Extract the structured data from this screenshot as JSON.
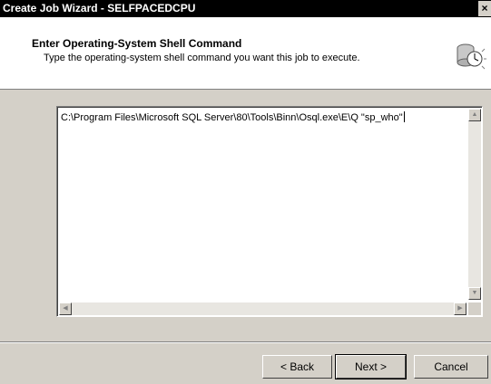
{
  "window": {
    "title": "Create Job Wizard - SELFPACEDCPU",
    "close_glyph": "×"
  },
  "header": {
    "title": "Enter Operating-System Shell Command",
    "subtitle": "Type the operating-system shell command you want this job to execute.",
    "icon": "job-schedule-icon"
  },
  "command": {
    "value": "C:\\Program Files\\Microsoft SQL Server\\80\\Tools\\Binn\\Osql.exe\\E\\Q \"sp_who\""
  },
  "buttons": {
    "back": "< Back",
    "next": "Next >",
    "cancel": "Cancel"
  },
  "scroll": {
    "up": "▲",
    "down": "▼",
    "left": "◀",
    "right": "▶"
  }
}
